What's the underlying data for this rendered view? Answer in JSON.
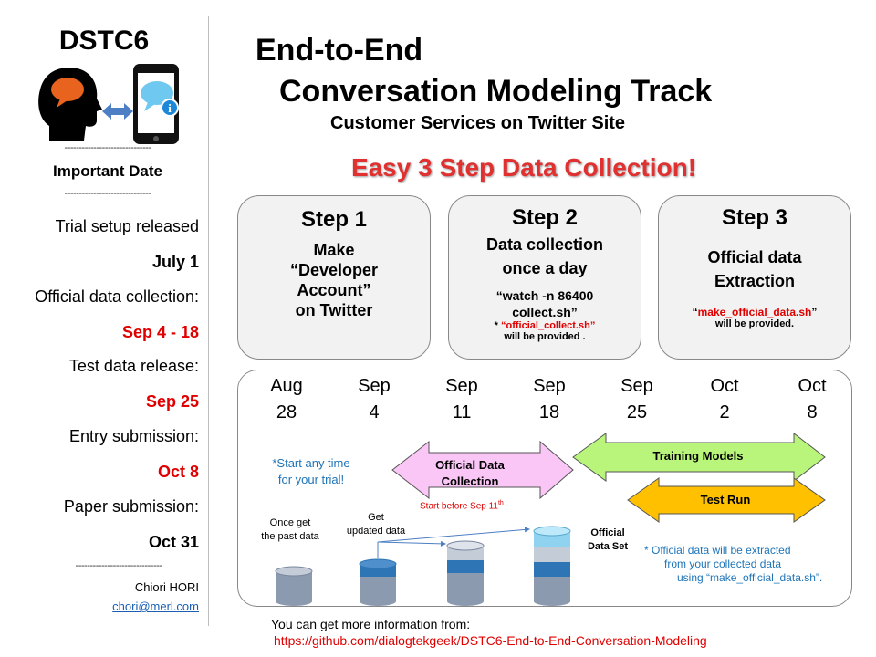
{
  "sidebar": {
    "logo_text": "DSTC6",
    "divider": "------------------------------",
    "heading": "Important Date",
    "schedule": [
      {
        "label": "Trial setup released",
        "date": "July 1",
        "date_color": "#000000"
      },
      {
        "label": "Official data collection:",
        "date": "Sep 4 - 18",
        "date_color": "#e00000"
      },
      {
        "label": "Test data release:",
        "date": "Sep 25",
        "date_color": "#e00000"
      },
      {
        "label": "Entry submission:",
        "date": "Oct 8",
        "date_color": "#e00000"
      },
      {
        "label": "Paper submission:",
        "date": "Oct 31",
        "date_color": "#000000"
      }
    ],
    "author": "Chiori HORI",
    "email": "chori@merl.com"
  },
  "header": {
    "title_line1": "End-to-End",
    "title_line2": "Conversation Modeling Track",
    "subtitle": "Customer Services on Twitter Site",
    "tagline": "Easy 3 Step Data Collection!"
  },
  "steps": [
    {
      "title": "Step 1",
      "text_lines": [
        "Make",
        "“Developer",
        "Account”",
        "on Twitter"
      ]
    },
    {
      "title": "Step 2",
      "text_lines": [
        "Data collection",
        "once a day"
      ],
      "command_lines": [
        "“watch -n 86400",
        "collect.sh”"
      ],
      "note_script": "“official_collect.sh”",
      "note_tail": "will be provided ."
    },
    {
      "title": "Step 3",
      "text_lines": [
        "Official data",
        "Extraction"
      ],
      "script": "make_official_data.sh",
      "note_tail": "will be provided."
    }
  ],
  "timeline": {
    "dates": [
      {
        "month": "Aug",
        "day": "28"
      },
      {
        "month": "Sep",
        "day": "4"
      },
      {
        "month": "Sep",
        "day": "11"
      },
      {
        "month": "Sep",
        "day": "18"
      },
      {
        "month": "Sep",
        "day": "25"
      },
      {
        "month": "Oct",
        "day": "2"
      },
      {
        "month": "Oct",
        "day": "8"
      }
    ],
    "start_note_lines": [
      "*Start  any time",
      "for your trial!"
    ],
    "collection_label_lines": [
      "Official Data",
      "Collection"
    ],
    "collection_note": "Start before Sep 11",
    "collection_note_sup": "th",
    "training_label": "Training Models",
    "test_label": "Test Run",
    "past_data_lines": [
      "Once get",
      "the past data"
    ],
    "updated_data_lines": [
      "Get",
      "updated data"
    ],
    "official_set_lines": [
      "Official",
      "Data Set"
    ],
    "extract_note_lines": [
      "* Official data will be extracted",
      "from your collected data",
      "using “make_official_data.sh”."
    ],
    "colors": {
      "collection": "#f9c6f6",
      "training": "#b9f57a",
      "test": "#ffc000",
      "db_top": "#c4ccd8",
      "db_body": "#8c9ab0",
      "db_update": "#2e75b6",
      "db_new": "#8fd3f0"
    }
  },
  "footer": {
    "line1": "You can get more information from:",
    "link": "https://github.com/dialogtekgeek/DSTC6-End-to-End-Conversation-Modeling"
  }
}
